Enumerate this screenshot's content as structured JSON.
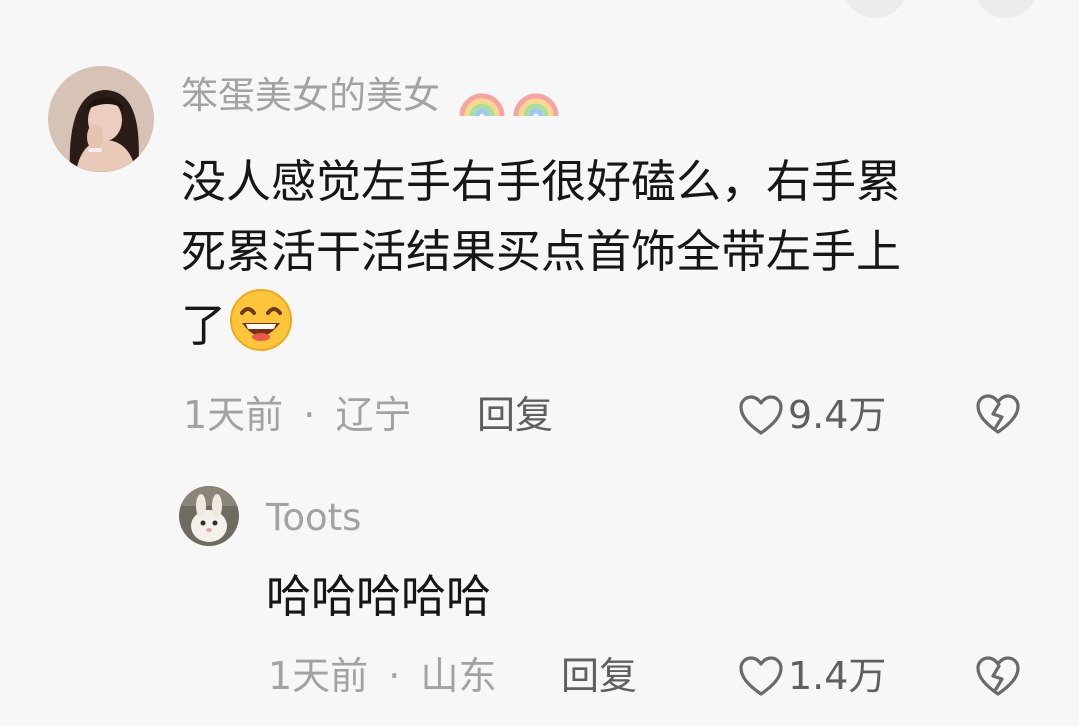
{
  "colors": {
    "background": "#f7f7f7",
    "text_primary": "#161616",
    "text_secondary": "#a2a2a2",
    "action_text": "#5f5f5f"
  },
  "comment": {
    "username": "笨蛋美女的美女",
    "username_badges": [
      "rainbow-icon",
      "rainbow-icon"
    ],
    "text_lines": [
      "没人感觉左手右手很好磕么，右手累",
      "死累活干活结果买点首饰全带左手上",
      "了"
    ],
    "emoji": "grinning-smile-emoji",
    "time": "1天前",
    "separator": "·",
    "location": "辽宁",
    "reply_label": "回复",
    "like_count": "9.4万"
  },
  "reply": {
    "username": "Toots",
    "text": "哈哈哈哈哈",
    "time": "1天前",
    "separator": "·",
    "location": "山东",
    "reply_label": "回复",
    "like_count": "1.4万"
  }
}
